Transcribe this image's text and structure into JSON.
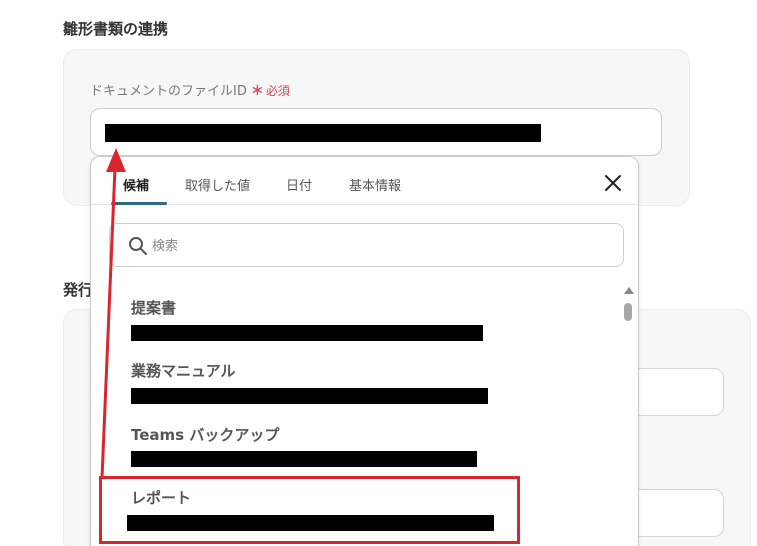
{
  "section": {
    "title": "雛形書類の連携",
    "next_title_fragment": "発行"
  },
  "field": {
    "label": "ドキュメントのファイルID",
    "required_mark": "＊",
    "required_text": "必須"
  },
  "popover": {
    "tabs": [
      {
        "label": "候補",
        "active": true
      },
      {
        "label": "取得した値",
        "active": false
      },
      {
        "label": "日付",
        "active": false
      },
      {
        "label": "基本情報",
        "active": false
      }
    ],
    "search": {
      "placeholder": "検索",
      "value": ""
    },
    "items": [
      {
        "name": "提案書",
        "id_redacted": true
      },
      {
        "name": "業務マニュアル",
        "id_redacted": true
      },
      {
        "name": "Teams バックアップ",
        "id_redacted": true
      },
      {
        "name": "レポート",
        "id_redacted": true,
        "highlighted": true
      }
    ]
  },
  "colors": {
    "accent_tab": "#2b6a7f",
    "required": "#e0405a",
    "annotation_red": "#d9252e"
  },
  "icons": {
    "close": "close-icon",
    "search": "search-icon",
    "scroll_up": "scroll-up-icon"
  }
}
